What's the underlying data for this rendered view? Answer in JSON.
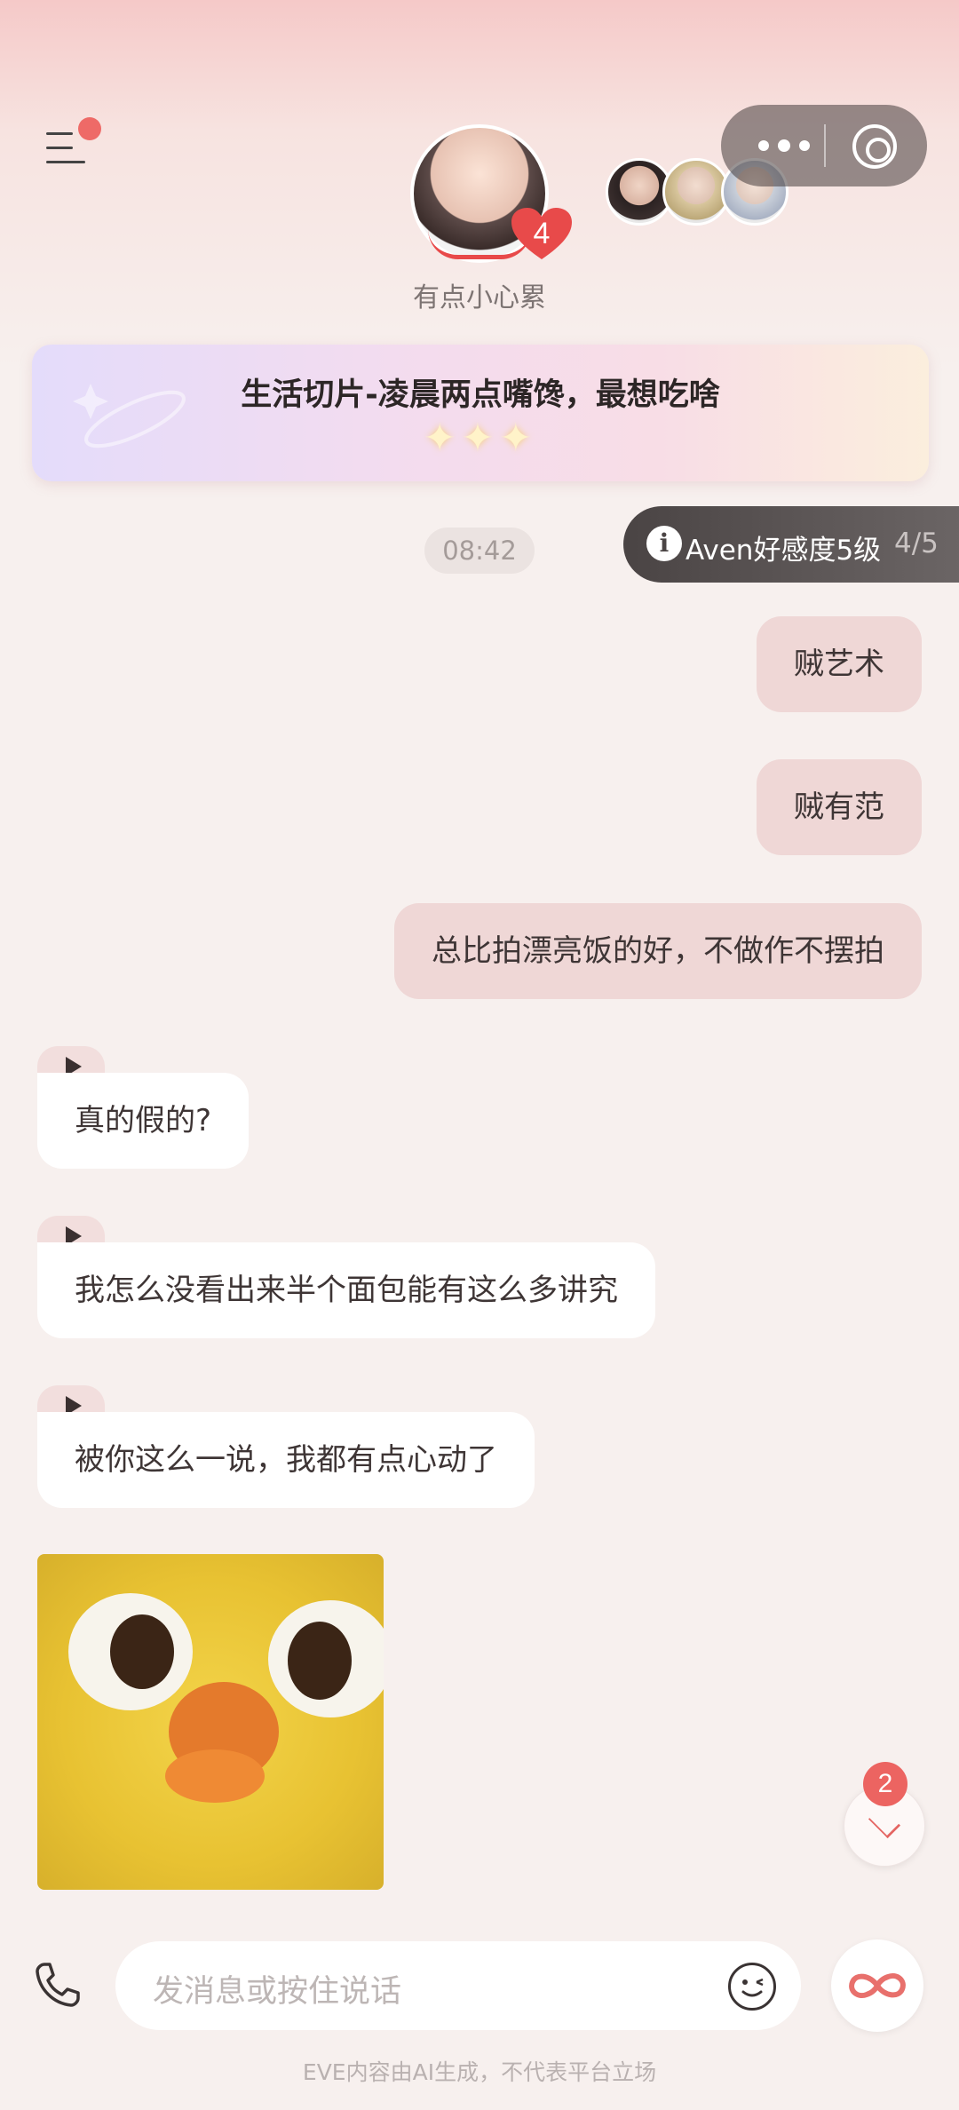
{
  "header": {
    "menu_icon": "menu-icon",
    "character_name": "有点小心累",
    "heart_level": "4",
    "capsule_more_icon": "more-dots-icon",
    "capsule_close_icon": "target-close-icon"
  },
  "story": {
    "title": "生活切片-凌晨两点嘴馋，最想吃啥",
    "stars": "✦✦✦"
  },
  "chat": {
    "timestamp": "08:42",
    "affinity_label": "Aven好感度5级",
    "affinity_count": "4/5",
    "messages_out": [
      "贼艺术",
      "贼有范",
      "总比拍漂亮饭的好，不做作不摆拍"
    ],
    "messages_in": [
      "真的假的?",
      "我怎么没看出来半个面包能有这么多讲究",
      "被你这么一说，我都有点心动了"
    ],
    "sticker": "chick-sticker"
  },
  "scroll": {
    "unread_count": "2"
  },
  "composer": {
    "placeholder": "发消息或按住说话",
    "phone_icon": "phone-icon",
    "emoji_icon": "emoji-icon",
    "infinity_icon": "infinity-icon"
  },
  "footer": {
    "disclaimer": "EVE内容由AI生成，不代表平台立场"
  },
  "colors": {
    "accent": "#ec6461",
    "bubble_out": "#efd7d6",
    "bubble_in": "#ffffff",
    "background": "#f7f0ee"
  }
}
